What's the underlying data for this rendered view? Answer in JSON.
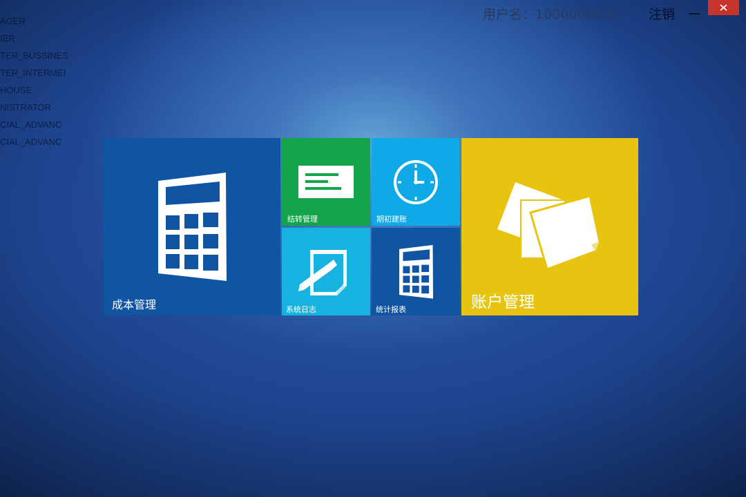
{
  "background_roles": [
    "AGER",
    "IER",
    "TER_BUSSINES",
    "TER_INTERMEI",
    "HOUSE",
    "NISTRATOR",
    "CIAL_ADVANC",
    "CIAL_ADVANC"
  ],
  "header": {
    "username_label": "用户名：1000000031",
    "logout_label": "注销"
  },
  "tiles": {
    "cost": {
      "label": "成本管理",
      "color": "#0f55a3",
      "icon": "calculator-icon"
    },
    "invoice": {
      "label": "结转管理",
      "color": "#12a54a",
      "icon": "document-icon"
    },
    "period": {
      "label": "期初建账",
      "color": "#10a9e8",
      "icon": "clock-icon"
    },
    "log": {
      "label": "系统日志",
      "color": "#16b3e0",
      "icon": "note-pencil-icon"
    },
    "report": {
      "label": "统计报表",
      "color": "#0f55a3",
      "icon": "calculator-icon"
    },
    "account": {
      "label": "账户管理",
      "color": "#e6c40f",
      "icon": "papers-icon"
    }
  }
}
